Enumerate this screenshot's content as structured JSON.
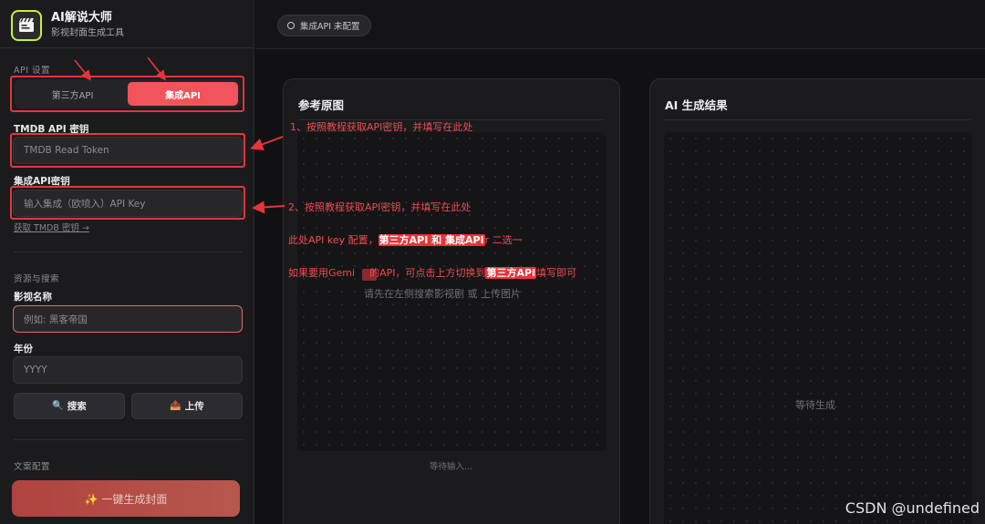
{
  "brand": {
    "title": "AI解说大师",
    "subtitle": "影视封面生成工具",
    "logo_icon": "film-clapper-icon"
  },
  "api_settings": {
    "section_label": "API 设置",
    "tabs": [
      {
        "label": "第三方API",
        "active": false
      },
      {
        "label": "集成API",
        "active": true
      }
    ],
    "tmdb_label": "TMDB API 密钥",
    "tmdb_placeholder": "TMDB Read Token",
    "integrated_label": "集成API密钥",
    "integrated_placeholder": "输入集成（欧喷入）API Key",
    "get_key_link": "获取 TMDB 密钥 →"
  },
  "search": {
    "section_label": "资源与搜索",
    "title_label": "影视名称",
    "title_placeholder": "例如: 黑客帝国",
    "year_label": "年份",
    "year_placeholder": "YYYY",
    "search_button": "搜索",
    "upload_button": "上传"
  },
  "copy_config": {
    "section_label": "文案配置",
    "generate_button": "✨ 一键生成封面"
  },
  "topbar": {
    "status": "集成API 未配置"
  },
  "panels": {
    "reference": {
      "title": "参考原图",
      "placeholder": "请先在左侧搜索影视剧 或 上传图片",
      "footer": "等待输入..."
    },
    "result": {
      "title": "AI 生成结果",
      "placeholder": "等待生成"
    }
  },
  "annotations": {
    "note1": "1、按照教程获取API密钥，并填写在此处",
    "note2": "2、按照教程获取API密钥，并填写在此处",
    "note3_pre": "此处API key 配置，",
    "note3_hl": "第三方API 和 集成API",
    "note3_post": "r 二选一",
    "note4_pre": "如果要用Gemi",
    "note4_mid": "的API，可点击上方切换到",
    "note4_hl": "第三方API",
    "note4_post": "填写即可",
    "accent_color": "#e8343a"
  },
  "watermark": "CSDN @undefined"
}
